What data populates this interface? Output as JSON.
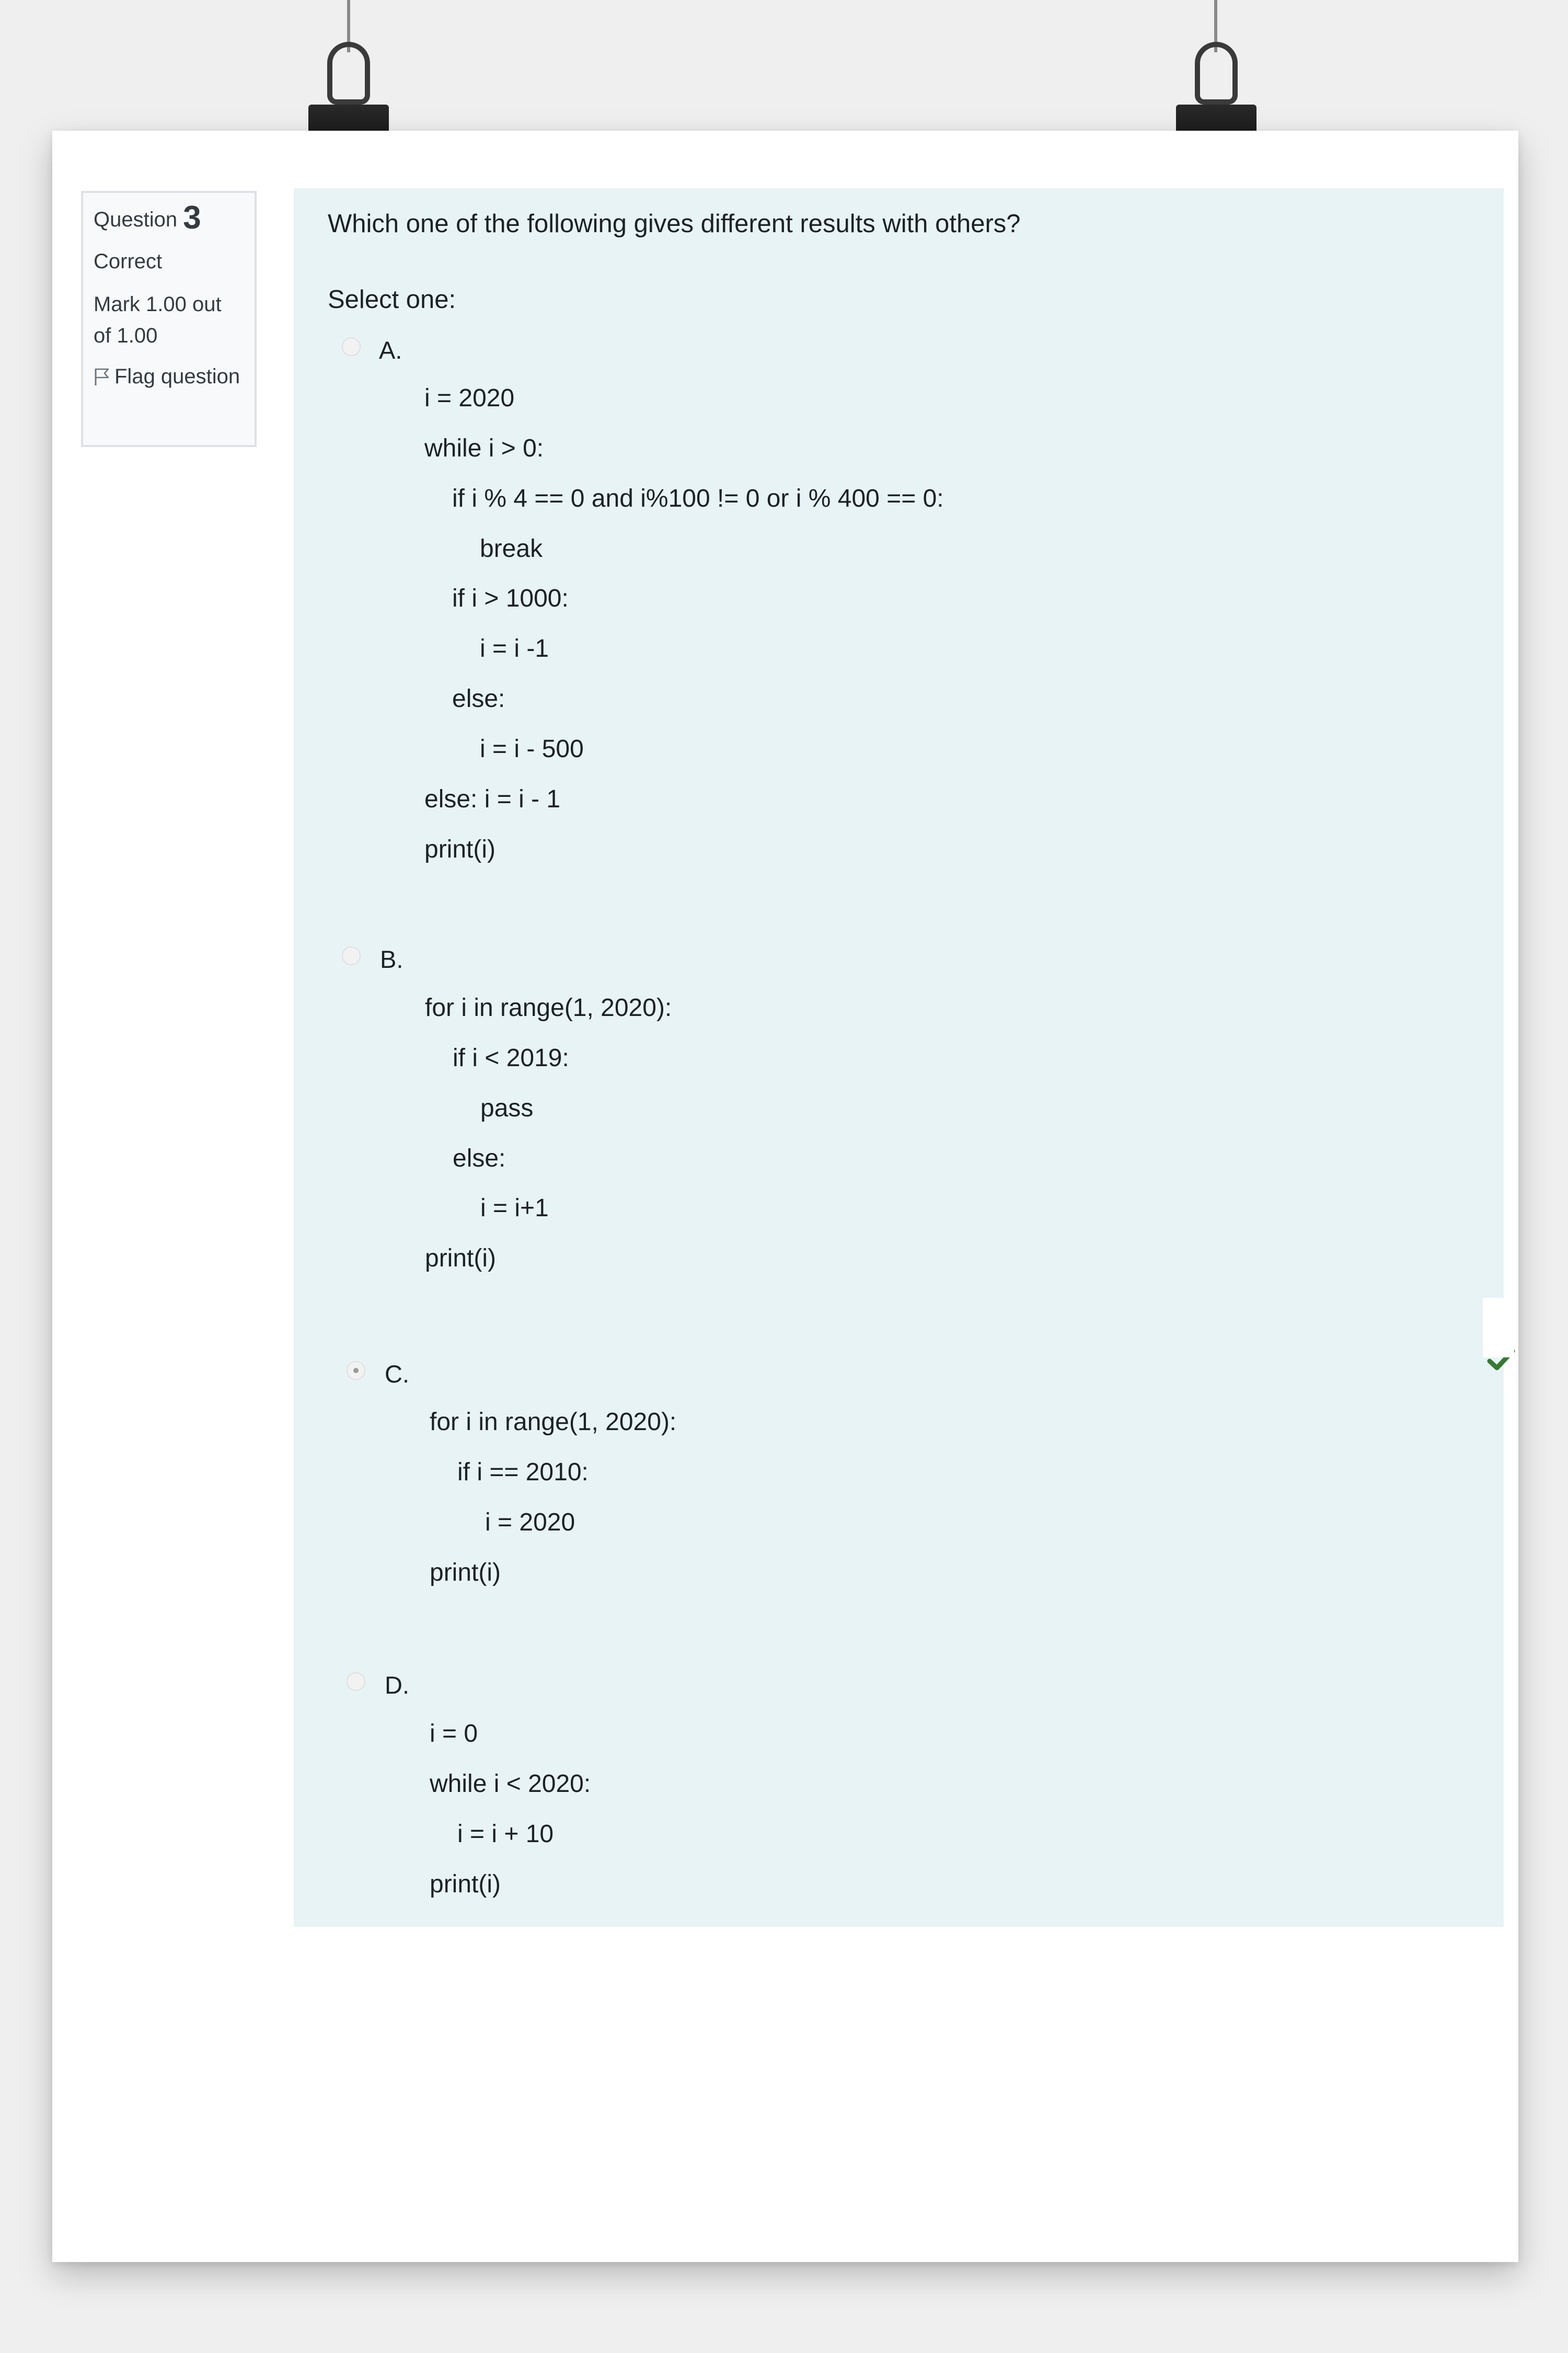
{
  "question_info": {
    "label": "Question",
    "number": "3",
    "state": "Correct",
    "grade": "Mark 1.00 out of 1.00",
    "flag_label": "Flag question"
  },
  "question": {
    "text": "Which one of the following gives different results with others?",
    "prompt": "Select one:"
  },
  "options": {
    "a": {
      "letter": "A.",
      "lines": [
        "i = 2020",
        "while i > 0:",
        "if i % 4 == 0 and i%100 != 0 or i % 400 == 0:",
        "break",
        "if i > 1000:",
        "i = i -1",
        "else:",
        "i = i - 500",
        "else: i = i - 1",
        "print(i)"
      ]
    },
    "b": {
      "letter": "B.",
      "lines": [
        "for i in range(1, 2020):",
        "if i < 2019:",
        "pass",
        "else:",
        "i = i+1",
        "print(i)"
      ]
    },
    "c": {
      "letter": "C.",
      "selected": true,
      "correct": true,
      "lines": [
        "for i in range(1, 2020):",
        "if i == 2010:",
        "i = 2020",
        "print(i)"
      ]
    },
    "d": {
      "letter": "D.",
      "lines": [
        "i = 0",
        "while i < 2020:",
        "i = i + 10",
        "print(i)"
      ]
    }
  },
  "icons": {
    "flag": "flag-icon",
    "correct": "check-icon"
  },
  "colors": {
    "answer_background": "#e7f3f5",
    "correct_check": "#357a32"
  }
}
